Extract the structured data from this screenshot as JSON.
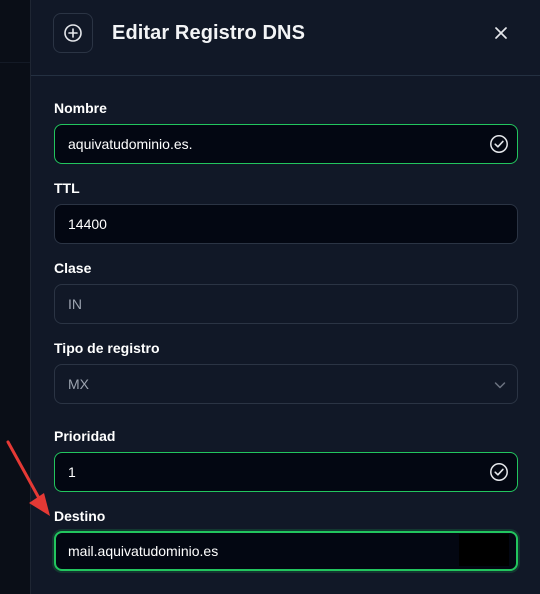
{
  "dialog": {
    "title": "Editar Registro DNS",
    "header_icon": "plus-circle-icon",
    "close_icon": "close-icon"
  },
  "fields": {
    "nombre": {
      "label": "Nombre",
      "value": "aquivatudominio.es.",
      "status_icon": "check-circle-icon"
    },
    "ttl": {
      "label": "TTL",
      "value": "14400"
    },
    "clase": {
      "label": "Clase",
      "value": "IN"
    },
    "tipo": {
      "label": "Tipo de registro",
      "value": "MX",
      "dropdown_icon": "chevron-down-icon"
    },
    "prioridad": {
      "label": "Prioridad",
      "value": "1",
      "status_icon": "check-circle-icon"
    },
    "destino": {
      "label": "Destino",
      "value": "mail.aquivatudominio.es"
    }
  },
  "annotation": {
    "arrow_color": "#e53935"
  },
  "colors": {
    "accent_valid": "#22c55e",
    "panel_bg": "#111827",
    "input_bg": "#030712"
  }
}
